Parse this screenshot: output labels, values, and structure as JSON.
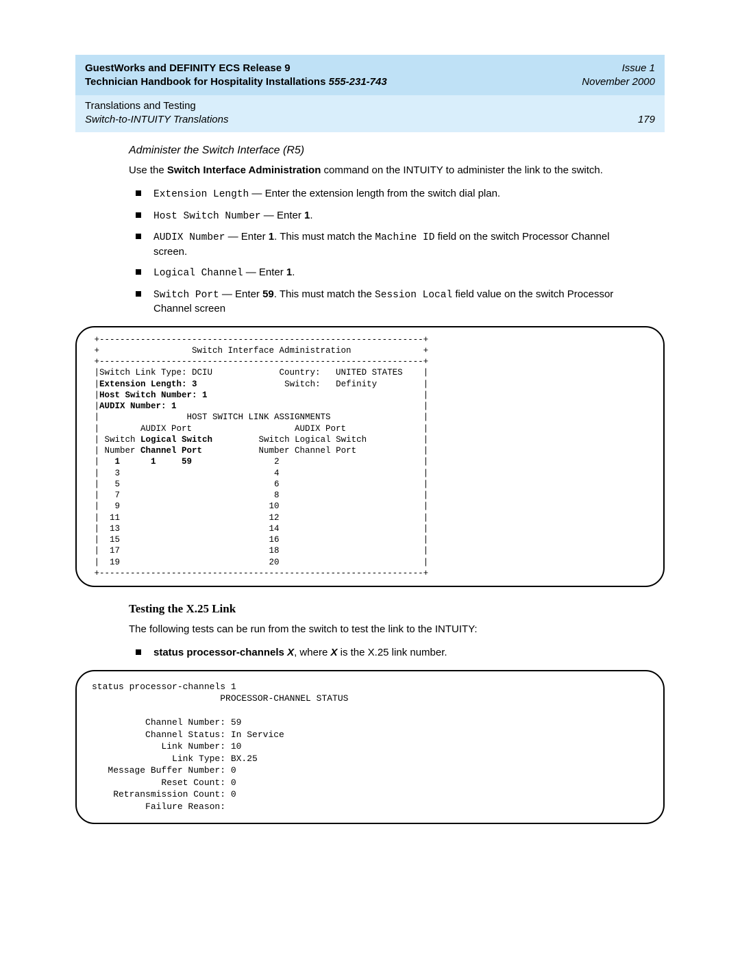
{
  "header": {
    "title_line1": "GuestWorks and DEFINITY ECS Release 9",
    "title_line2_a": "Technician Handbook for Hospitality Installations  ",
    "title_line2_b": "555-231-743",
    "issue": "Issue 1",
    "date": "November 2000",
    "chapter": "Translations and Testing",
    "section": "Switch-to-INTUITY Translations",
    "page": "179"
  },
  "body": {
    "subhead": "Administer the Switch Interface (R5)",
    "intro_a": "Use the ",
    "intro_b": "Switch Interface Administration",
    "intro_c": " command on the INTUITY to administer the link to the switch.",
    "items": [
      {
        "code": "Extension Length",
        "tail": " — Enter the extension length from the switch dial plan."
      },
      {
        "code": "Host Switch Number",
        "tail": " — Enter ",
        "bold": "1",
        "after": "."
      },
      {
        "code": "AUDIX Number",
        "tail": " — Enter ",
        "bold": "1",
        "after": ". This must match the ",
        "code2": "Machine ID",
        "after2": " field on the switch Processor Channel screen."
      },
      {
        "code": "Logical Channel",
        "tail": " — Enter ",
        "bold": "1",
        "after": "."
      },
      {
        "code": "Switch Port",
        "tail": " — Enter ",
        "bold": "59",
        "after": ". This must match the ",
        "code2": "Session Local",
        "after2": " field value on the switch Processor Channel screen"
      }
    ],
    "term1": " +---------------------------------------------------------------+\n +                  Switch Interface Administration              +\n +---------------------------------------------------------------+\n |Switch Link Type: DCIU             Country:   UNITED STATES    |\n |<b>Extension Length: 3</b>                 Switch:   Definity         |\n |<b>Host Switch Number: 1</b>                                          |\n |<b>AUDIX Number: 1</b>                                                |\n |                 HOST SWITCH LINK ASSIGNMENTS                  |\n |        AUDIX Port                    AUDIX Port               |\n | Switch <b>Logical Switch</b>         Switch Logical Switch           |\n | Number <b>Channel Port</b>           Number Channel Port             |\n |   <b>1      1     59</b>                2                            |\n |   3                              4                            |\n |   5                              6                            |\n |   7                              8                            |\n |   9                             10                            |\n |  11                             12                            |\n |  13                             14                            |\n |  15                             16                            |\n |  17                             18                            |\n |  19                             20                            |\n +---------------------------------------------------------------+",
    "h3": "Testing the X.25 Link",
    "test_intro": "The following tests can be run from the switch to test the link to the INTUITY:",
    "test_item_b": "status processor-channels ",
    "test_item_bi": "X",
    "test_item_c": ", where ",
    "test_item_bi2": "X",
    "test_item_d": " is the X.25 link number.",
    "term2": "status processor-channels 1\n                        PROCESSOR-CHANNEL STATUS\n\n          Channel Number: 59\n          Channel Status: In Service\n             Link Number: 10\n               Link Type: BX.25\n   Message Buffer Number: 0\n             Reset Count: 0\n    Retransmission Count: 0\n          Failure Reason:"
  },
  "chart_data": {
    "type": "table",
    "title": "Switch Interface Administration",
    "fields": {
      "Switch Link Type": "DCIU",
      "Country": "UNITED STATES",
      "Extension Length": 3,
      "Switch": "Definity",
      "Host Switch Number": 1,
      "AUDIX Number": 1
    },
    "host_switch_link_assignments": {
      "columns": [
        "Switch Number",
        "Logical Channel",
        "Switch Port"
      ],
      "rows_left": [
        {
          "Switch Number": 1,
          "Logical Channel": 1,
          "Switch Port": 59
        },
        {
          "Switch Number": 3
        },
        {
          "Switch Number": 5
        },
        {
          "Switch Number": 7
        },
        {
          "Switch Number": 9
        },
        {
          "Switch Number": 11
        },
        {
          "Switch Number": 13
        },
        {
          "Switch Number": 15
        },
        {
          "Switch Number": 17
        },
        {
          "Switch Number": 19
        }
      ],
      "rows_right": [
        {
          "Switch Number": 2
        },
        {
          "Switch Number": 4
        },
        {
          "Switch Number": 6
        },
        {
          "Switch Number": 8
        },
        {
          "Switch Number": 10
        },
        {
          "Switch Number": 12
        },
        {
          "Switch Number": 14
        },
        {
          "Switch Number": 16
        },
        {
          "Switch Number": 18
        },
        {
          "Switch Number": 20
        }
      ]
    },
    "processor_channel_status": {
      "command": "status processor-channels 1",
      "Channel Number": 59,
      "Channel Status": "In Service",
      "Link Number": 10,
      "Link Type": "BX.25",
      "Message Buffer Number": 0,
      "Reset Count": 0,
      "Retransmission Count": 0,
      "Failure Reason": ""
    }
  }
}
